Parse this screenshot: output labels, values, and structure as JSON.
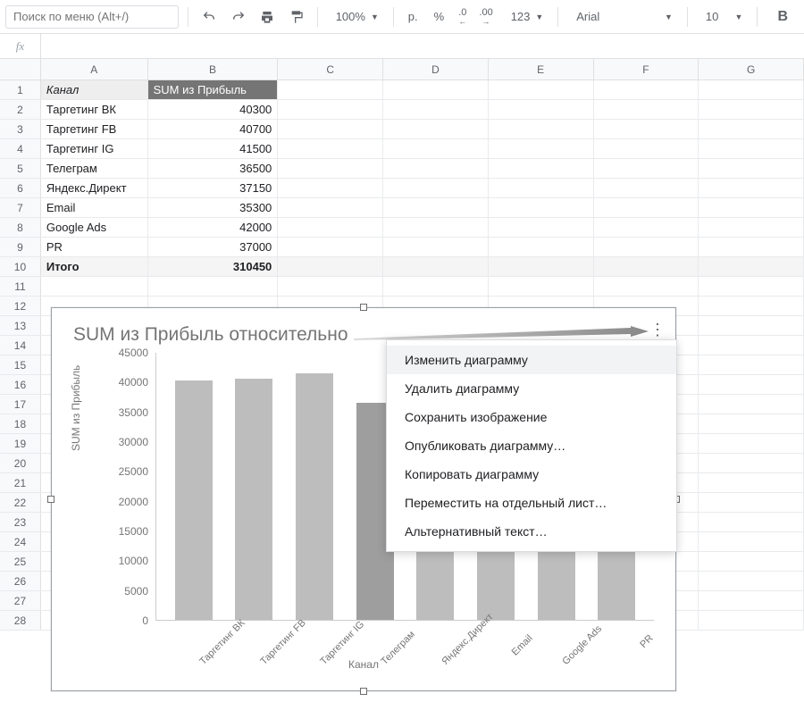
{
  "toolbar": {
    "search_placeholder": "Поиск по меню (Alt+/)",
    "zoom": "100%",
    "currency": "р.",
    "percent": "%",
    "dec_dec": ".0",
    "dec_inc": ".00",
    "num_format": "123",
    "font_name": "Arial",
    "font_size": "10",
    "bold": "B"
  },
  "fx": {
    "label": "fx",
    "value": ""
  },
  "columns": [
    "A",
    "B",
    "C",
    "D",
    "E",
    "F",
    "G"
  ],
  "col_widths": {
    "A": 120,
    "B": 146,
    "C": 118,
    "D": 118,
    "E": 118,
    "F": 118,
    "G": 118
  },
  "table": {
    "header": {
      "a": "Канал",
      "b": "SUM из Прибыль"
    },
    "rows": [
      {
        "a": "Таргетинг ВК",
        "b": "40300"
      },
      {
        "a": "Таргетинг FB",
        "b": "40700"
      },
      {
        "a": "Таргетинг IG",
        "b": "41500"
      },
      {
        "a": "Телеграм",
        "b": "36500"
      },
      {
        "a": "Яндекс.Директ",
        "b": "37150"
      },
      {
        "a": "Email",
        "b": "35300"
      },
      {
        "a": "Google Ads",
        "b": "42000"
      },
      {
        "a": "PR",
        "b": "37000"
      }
    ],
    "total": {
      "a": "Итого",
      "b": "310450"
    }
  },
  "row_count": 28,
  "chart": {
    "title": "SUM из Прибыль относительно",
    "ylabel": "SUM из Прибыль",
    "xlabel": "Канал",
    "y_ticks": [
      "0",
      "5000",
      "10000",
      "15000",
      "20000",
      "25000",
      "30000",
      "35000",
      "40000",
      "45000"
    ]
  },
  "chart_data": {
    "type": "bar",
    "title": "SUM из Прибыль относительно Канал",
    "xlabel": "Канал",
    "ylabel": "SUM из Прибыль",
    "ylim": [
      0,
      45000
    ],
    "categories": [
      "Таргетинг ВК",
      "Таргетинг FB",
      "Таргетинг IG",
      "Телеграм",
      "Яндекс.Директ",
      "Email",
      "Google Ads",
      "PR"
    ],
    "values": [
      40300,
      40700,
      41500,
      36500,
      37150,
      35300,
      42000,
      37000
    ]
  },
  "context_menu": {
    "items": [
      "Изменить диаграмму",
      "Удалить диаграмму",
      "Сохранить изображение",
      "Опубликовать диаграмму…",
      "Копировать диаграмму",
      "Переместить на отдельный лист…",
      "Альтернативный текст…"
    ],
    "hover_index": 0
  }
}
